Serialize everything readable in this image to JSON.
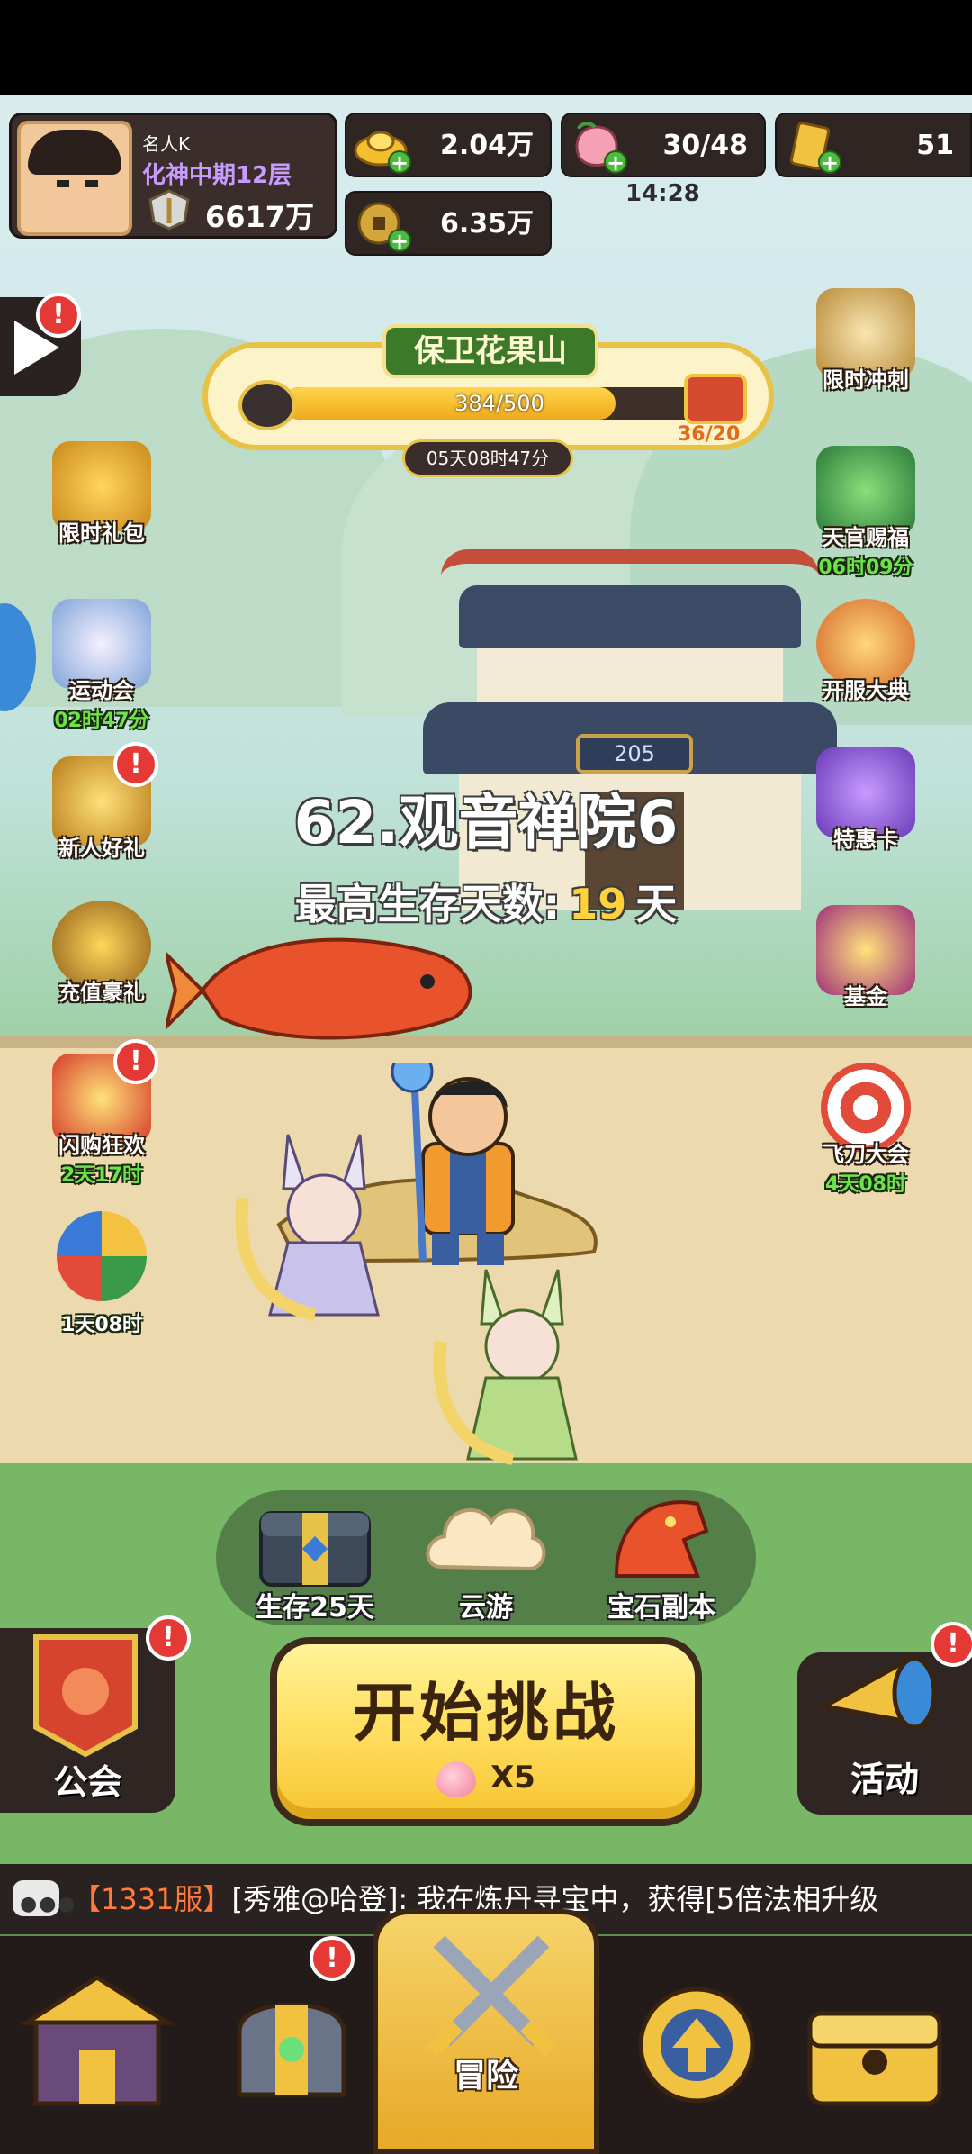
{
  "player": {
    "name": "名人K",
    "rank": "化神中期12层",
    "power": "6617万"
  },
  "resources": {
    "gold_ingot": "2.04万",
    "peach_stamina": "30/48",
    "stamina_timer": "14:28",
    "ticket": "51",
    "coin": "6.35万"
  },
  "event_banner": {
    "title": "保卫花果山",
    "progress_text": "384/500",
    "progress_fraction": 0.768,
    "chest_count": "36/20",
    "countdown": "05天08时47分"
  },
  "left_icons": [
    {
      "label": "限时礼包",
      "timer": "",
      "badge": false
    },
    {
      "label": "运动会",
      "timer": "02时47分",
      "badge": false
    },
    {
      "label": "新人好礼",
      "timer": "",
      "badge": true
    },
    {
      "label": "充值豪礼",
      "timer": "",
      "badge": false
    },
    {
      "label": "闪购狂欢",
      "timer": "2天17时",
      "badge": true
    },
    {
      "label": "",
      "timer": "1天08时",
      "badge": false
    }
  ],
  "right_icons": [
    {
      "label": "限时冲刺",
      "timer": ""
    },
    {
      "label": "天官赐福",
      "timer": "06时09分"
    },
    {
      "label": "开服大典",
      "timer": ""
    },
    {
      "label": "特惠卡",
      "timer": ""
    },
    {
      "label": "基金",
      "timer": ""
    },
    {
      "label": "飞刀大会",
      "timer": "4天08时"
    }
  ],
  "temple_plaque": "205",
  "stage": {
    "title": "62.观音禅院6",
    "best_label": "最高生存天数:",
    "best_value": "19",
    "best_unit": "天"
  },
  "modes": [
    {
      "label": "生存25天",
      "icon": "treasure-chest-icon"
    },
    {
      "label": "云游",
      "icon": "cloud-icon"
    },
    {
      "label": "宝石副本",
      "icon": "dragon-icon"
    }
  ],
  "start_button": {
    "label": "开始挑战",
    "cost": "X5"
  },
  "guild": {
    "label": "公会"
  },
  "activity": {
    "label": "活动"
  },
  "badge_mark": "!",
  "chat": {
    "server": "【1331服】",
    "text": "[秀雅@哈登]: 我在炼丹寻宝中，获得[5倍法相升级"
  },
  "nav": {
    "tabs": [
      {
        "icon": "shop-icon",
        "label": ""
      },
      {
        "icon": "helmet-icon",
        "label": "",
        "badge": true
      },
      {
        "icon": "crossed-swords-icon",
        "label": "冒险"
      },
      {
        "icon": "upgrade-arrow-icon",
        "label": ""
      },
      {
        "icon": "chest-icon",
        "label": ""
      }
    ]
  },
  "colors": {
    "accent_gold": "#ffd23c",
    "timer_green": "#6de34a",
    "badge_red": "#e53935",
    "rank_purple": "#c89bff"
  }
}
